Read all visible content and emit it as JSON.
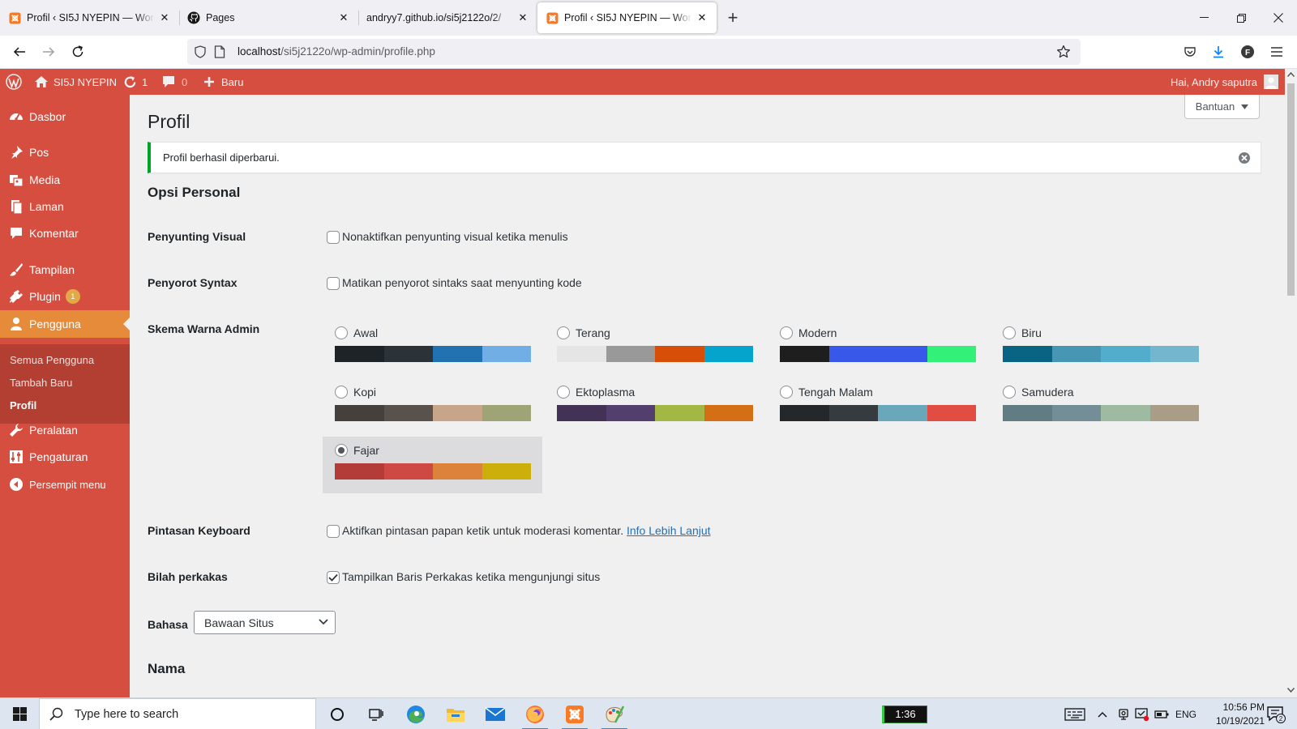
{
  "browser": {
    "tabs": [
      {
        "title": "Profil ‹ SI5J NYEPIN — WordPress",
        "icon": "xampp-icon",
        "active": false
      },
      {
        "title": "Pages",
        "icon": "github-icon",
        "active": false
      },
      {
        "title": "andryy7.github.io/si5j2122o/2/",
        "icon": "",
        "active": false
      },
      {
        "title": "Profil ‹ SI5J NYEPIN — WordPress",
        "icon": "xampp-icon",
        "active": true
      }
    ],
    "url_host": "localhost",
    "url_path": "/si5j2122o/wp-admin/profile.php"
  },
  "adminbar": {
    "site_name": "SI5J NYEPIN",
    "updates_count": "1",
    "comments_count": "0",
    "new_label": "Baru",
    "greeting": "Hai, Andry saputra"
  },
  "sidemenu": {
    "items": [
      {
        "label": "Dasbor",
        "icon": "dashboard-icon"
      },
      {
        "label": "Pos",
        "icon": "pin-icon"
      },
      {
        "label": "Media",
        "icon": "media-icon"
      },
      {
        "label": "Laman",
        "icon": "page-icon"
      },
      {
        "label": "Komentar",
        "icon": "comment-icon"
      },
      {
        "label": "Tampilan",
        "icon": "brush-icon"
      },
      {
        "label": "Plugin",
        "icon": "plugin-icon",
        "badge": "1"
      },
      {
        "label": "Pengguna",
        "icon": "user-icon",
        "current": true
      },
      {
        "label": "Peralatan",
        "icon": "wrench-icon"
      },
      {
        "label": "Pengaturan",
        "icon": "settings-icon"
      },
      {
        "label": "Persempit menu",
        "icon": "collapse-icon"
      }
    ],
    "submenu": [
      "Semua Pengguna",
      "Tambah Baru",
      "Profil"
    ]
  },
  "content": {
    "help_label": "Bantuan",
    "page_title": "Profil",
    "notice": "Profil berhasil diperbarui.",
    "section_personal": "Opsi Personal",
    "section_name": "Nama",
    "rows": {
      "visual_editor": {
        "label": "Penyunting Visual",
        "option": "Nonaktifkan penyunting visual ketika menulis",
        "checked": false
      },
      "syntax": {
        "label": "Penyorot Syntax",
        "option": "Matikan penyorot sintaks saat menyunting kode",
        "checked": false
      },
      "color_scheme": {
        "label": "Skema Warna Admin"
      },
      "keyboard": {
        "label": "Pintasan Keyboard",
        "option": "Aktifkan pintasan papan ketik untuk moderasi komentar.",
        "link": "Info Lebih Lanjut",
        "checked": false
      },
      "toolbar": {
        "label": "Bilah perkakas",
        "option": "Tampilkan Baris Perkakas ketika mengunjungi situs",
        "checked": true
      },
      "language": {
        "label": "Bahasa",
        "value": "Bawaan Situs"
      }
    },
    "schemes": [
      {
        "name": "Awal",
        "colors": [
          "#1d2327",
          "#2c3338",
          "#2271b1",
          "#72aee6"
        ]
      },
      {
        "name": "Terang",
        "colors": [
          "#e5e5e5",
          "#999999",
          "#d64e07",
          "#04a4cc"
        ]
      },
      {
        "name": "Modern",
        "colors": [
          "#1e1e1e",
          "#3858e9",
          "#3858e9",
          "#33f078"
        ]
      },
      {
        "name": "Biru",
        "colors": [
          "#096484",
          "#4796b3",
          "#52accc",
          "#74b6ce"
        ]
      },
      {
        "name": "Kopi",
        "colors": [
          "#46403c",
          "#59524c",
          "#c7a589",
          "#9ea476"
        ]
      },
      {
        "name": "Ektoplasma",
        "colors": [
          "#413256",
          "#523f6d",
          "#a3b745",
          "#d46f15"
        ]
      },
      {
        "name": "Tengah Malam",
        "colors": [
          "#25282b",
          "#363b3f",
          "#69a8bb",
          "#e14d43"
        ]
      },
      {
        "name": "Samudera",
        "colors": [
          "#627c83",
          "#738e96",
          "#9ebaa0",
          "#aa9d88"
        ]
      },
      {
        "name": "Fajar",
        "colors": [
          "#b43c38",
          "#cf4944",
          "#dd823b",
          "#ccaf0b"
        ],
        "selected": true
      }
    ]
  },
  "taskbar": {
    "search_placeholder": "Type here to search",
    "timer": "1:36",
    "lang": "ENG",
    "time": "10:56 PM",
    "date": "10/19/2021",
    "notification_count": "2"
  },
  "colors": {
    "admin_bar": "#d54e3f",
    "menu_current": "#e58b3a",
    "notice_border": "#00a32a"
  }
}
